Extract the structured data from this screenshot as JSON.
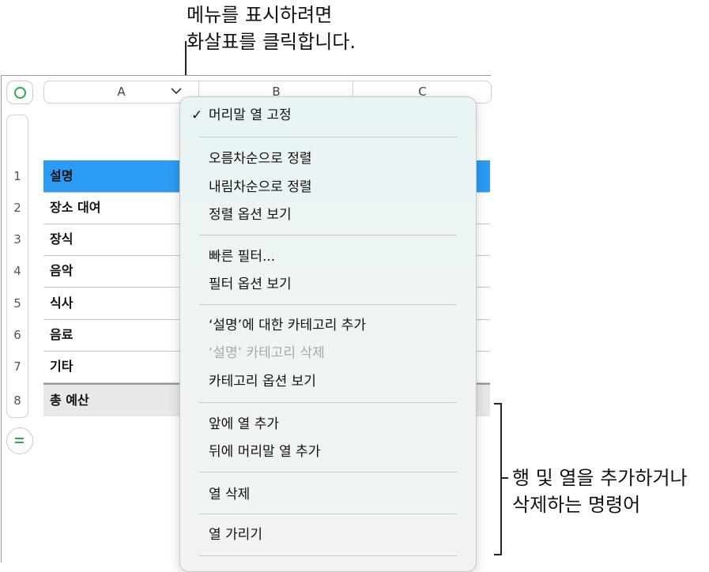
{
  "callouts": {
    "top_line1": "메뉴를 표시하려면",
    "top_line2": "화살표를 클릭합니다.",
    "right_line1": "행 및 열을 추가하거나",
    "right_line2": "삭제하는 명령어"
  },
  "columns": [
    "A",
    "B",
    "C"
  ],
  "rows": [
    {
      "num": "1",
      "label": "설명"
    },
    {
      "num": "2",
      "label": "장소 대여"
    },
    {
      "num": "3",
      "label": "장식"
    },
    {
      "num": "4",
      "label": "음악"
    },
    {
      "num": "5",
      "label": "식사"
    },
    {
      "num": "6",
      "label": "음료"
    },
    {
      "num": "7",
      "label": "기타"
    },
    {
      "num": "8",
      "label": "총 예산"
    }
  ],
  "menu": {
    "freeze_header": "머리말 열 고정",
    "check_mark": "✓",
    "sort_asc": "오름차순으로 정렬",
    "sort_desc": "내림차순으로 정렬",
    "show_sort_options": "정렬 옵션 보기",
    "quick_filter": "빠른 필터...",
    "show_filter_options": "필터 옵션 보기",
    "add_category": "‘설명’에 대한 카테고리 추가",
    "delete_category": "‘설명’ 카테고리 삭제",
    "show_category_options": "카테고리 옵션 보기",
    "add_column_before": "앞에 열 추가",
    "add_header_column_after": "뒤에 머리말 열 추가",
    "delete_column": "열 삭제",
    "hide_column": "열 가리기"
  },
  "icons": {
    "select_all": "circle-icon",
    "column_menu": "chevron-down-icon",
    "add_row": "equals-icon"
  },
  "colors": {
    "header_row": "#2b9bf4",
    "footer_row": "#e8e8e8",
    "accent_green": "#2fa84f"
  }
}
